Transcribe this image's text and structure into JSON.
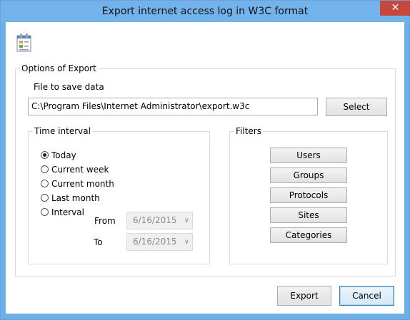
{
  "window": {
    "title": "Export internet access log in W3C format",
    "close_glyph": "✕"
  },
  "app_icon": "document-icon",
  "options": {
    "legend": "Options of Export",
    "file_label": "File to save data",
    "file_path": "C:\\Program Files\\Internet Administrator\\export.w3c",
    "select_button": "Select"
  },
  "time_interval": {
    "legend": "Time interval",
    "options": [
      {
        "label": "Today",
        "checked": true
      },
      {
        "label": "Current week",
        "checked": false
      },
      {
        "label": "Current month",
        "checked": false
      },
      {
        "label": "Last month",
        "checked": false
      },
      {
        "label": "Interval",
        "checked": false
      }
    ],
    "from_label": "From",
    "from_value": "6/16/2015",
    "to_label": "To",
    "to_value": "6/16/2015"
  },
  "filters": {
    "legend": "Filters",
    "buttons": [
      "Users",
      "Groups",
      "Protocols",
      "Sites",
      "Categories"
    ]
  },
  "footer": {
    "export_button": "Export",
    "cancel_button": "Cancel"
  }
}
